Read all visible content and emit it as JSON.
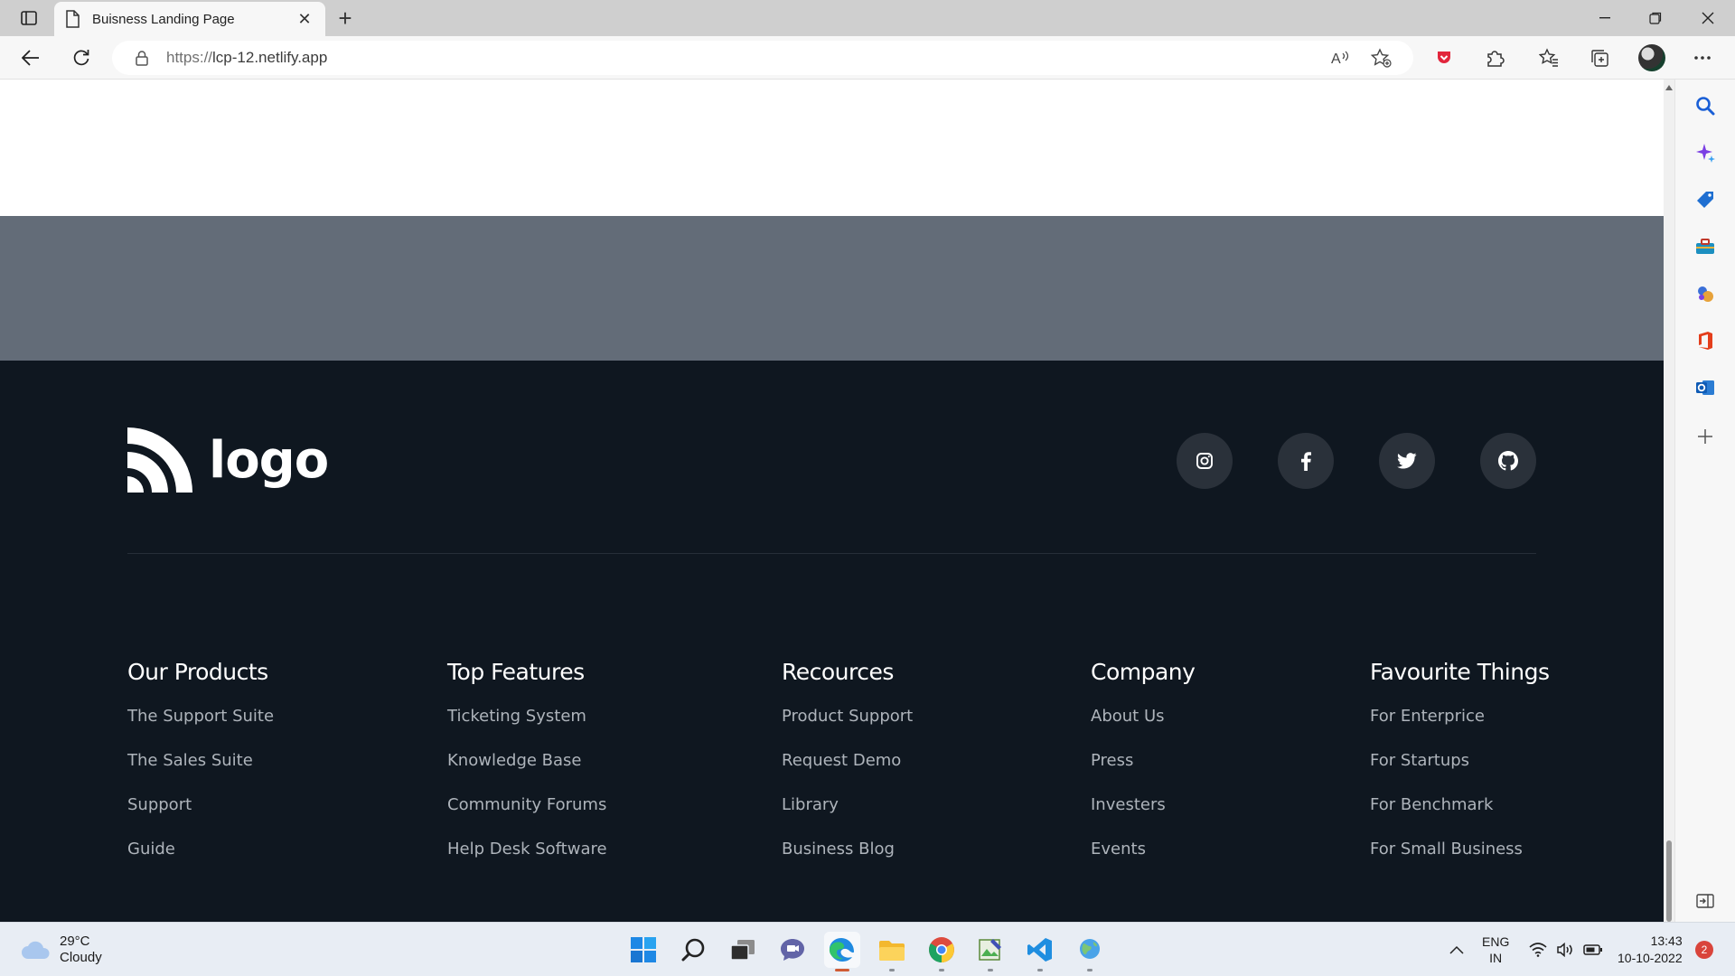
{
  "browser": {
    "tab_title": "Buisness Landing Page",
    "url_protocol": "https://",
    "url_host": "lcp-12.netlify.app"
  },
  "page": {
    "logo_text": "logo",
    "socials": [
      {
        "icon": "instagram-icon"
      },
      {
        "icon": "facebook-icon"
      },
      {
        "icon": "twitter-icon"
      },
      {
        "icon": "github-icon"
      }
    ],
    "columns": [
      {
        "title": "Our Products",
        "links": [
          "The Support Suite",
          "The Sales Suite",
          "Support",
          "Guide"
        ]
      },
      {
        "title": "Top Features",
        "links": [
          "Ticketing System",
          "Knowledge Base",
          "Community Forums",
          "Help Desk Software"
        ]
      },
      {
        "title": "Recources",
        "links": [
          "Product Support",
          "Request Demo",
          "Library",
          "Business Blog"
        ]
      },
      {
        "title": "Company",
        "links": [
          "About Us",
          "Press",
          "Investers",
          "Events"
        ]
      },
      {
        "title": "Favourite Things",
        "links": [
          "For Enterprice",
          "For Startups",
          "For Benchmark",
          "For Small Business"
        ]
      }
    ],
    "colors": {
      "footer_bg": "#0f1720",
      "band_bg": "#636c78",
      "link": "#aeb4bb"
    }
  },
  "taskbar": {
    "weather_temp": "29°C",
    "weather_desc": "Cloudy",
    "lang_top": "ENG",
    "lang_bottom": "IN",
    "time": "13:43",
    "date": "10-10-2022",
    "notif_count": "2"
  }
}
